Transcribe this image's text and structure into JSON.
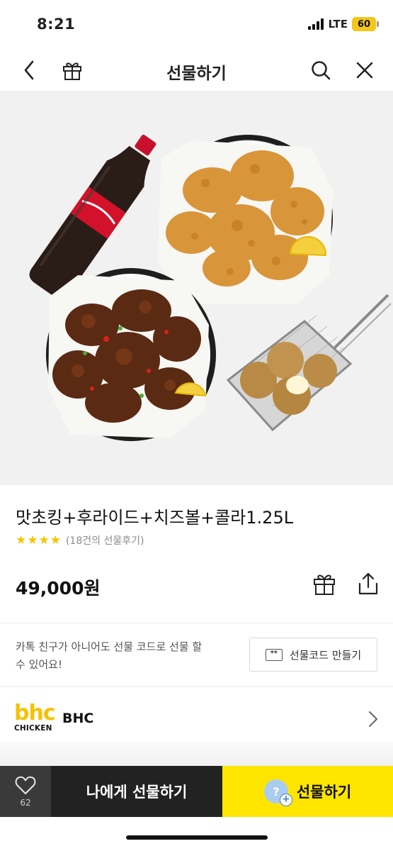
{
  "status": {
    "time": "8:21",
    "network": "LTE",
    "battery": "60"
  },
  "nav": {
    "title": "선물하기",
    "back_icon": "chevron-left-icon",
    "gift_icon": "gift-icon",
    "search_icon": "search-icon",
    "close_icon": "close-icon"
  },
  "product": {
    "title": "맛초킹+후라이드+치즈볼+콜라1.25L",
    "stars": "★★★★",
    "review_text": "(18건의 선물후기)",
    "price": "49,000원"
  },
  "gift_code": {
    "description": "카톡 친구가 아니어도 선물 코드로 선물 할 수 있어요!",
    "badge": "**",
    "button_label": "선물코드 만들기"
  },
  "brand": {
    "logo_top": "bhc",
    "logo_bottom": "CHICKEN",
    "name": "BHC",
    "logo_color": "#f5c200"
  },
  "bottom": {
    "like_count": "62",
    "self_gift_label": "나에게 선물하기",
    "gift_label": "선물하기",
    "avatar_text": "?",
    "avatar_plus": "+",
    "accent": "#fee500"
  }
}
